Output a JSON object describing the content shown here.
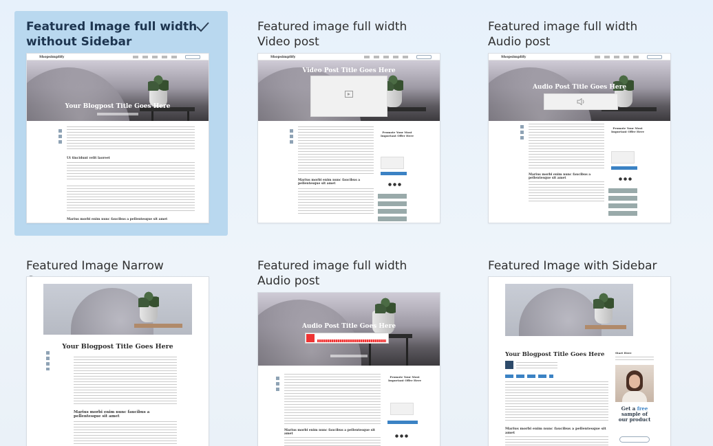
{
  "layouts": [
    {
      "title": "Featured Image full width without Sidebar",
      "selected": true,
      "hero_title": "Your Blogpost Title Goes Here",
      "subhead": "Marius morbi enim nunc faucibus a pellentesque sit amet"
    },
    {
      "title": "Featured image full width Video post",
      "selected": false,
      "hero_title": "Video Post Title Goes Here",
      "subhead": "Marius morbi enim nunc faucibus a pellentesque sit amet",
      "sidebar_title": "Promote Your Most Important Offer Here"
    },
    {
      "title": "Featured image full width Audio post",
      "selected": false,
      "hero_title": "Audio Post Title Goes Here",
      "subhead": "Marius morbi enim nunc faucibus a pellentesque sit amet",
      "sidebar_title": "Promote Your Most Important Offer Here"
    },
    {
      "title": "Featured Image Narrow Content",
      "selected": false,
      "hero_title": "Your Blogpost Title Goes Here",
      "subhead": "Marius morbi enim nunc faucibus a pellentesque sit amet"
    },
    {
      "title": "Featured image full width Audio post",
      "selected": false,
      "hero_title": "Audio Post Title Goes Here",
      "subhead": "Marius morbi enim nunc faucibus a pellentesque sit amet",
      "sidebar_title": "Promote Your Most Important Offer Here"
    },
    {
      "title": "Featured Image with Sidebar",
      "selected": false,
      "hero_title": "Your Blogpost Title Goes Here",
      "subhead": "Marius morbi enim nunc faucibus a pellentesque sit amet",
      "promo_line1": "Get a",
      "promo_free": "free",
      "promo_line2": "sample of",
      "promo_line3": "our product"
    }
  ],
  "logo": "Shopsimplify",
  "icons": {
    "selected_check": "check-icon",
    "video_placeholder": "video-icon",
    "audio_placeholder": "speaker-icon"
  },
  "colors": {
    "selected_bg": "#b9d8ef",
    "accent": "#3b82c4"
  }
}
